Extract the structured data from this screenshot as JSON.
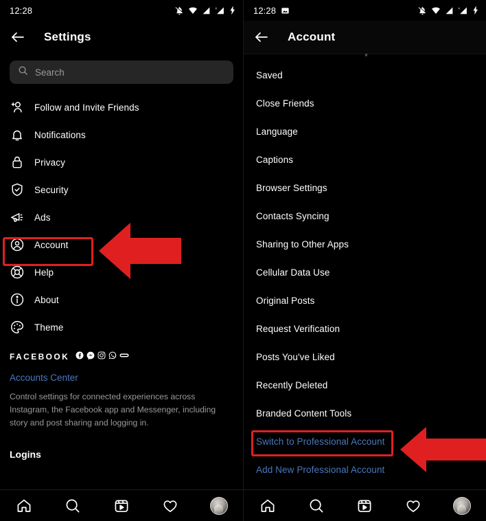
{
  "status": {
    "time": "12:28",
    "left_icons": [
      "image-icon"
    ],
    "right_icons": [
      "bell-muted-icon",
      "wifi-icon",
      "signal-icon",
      "signal-no-sim-icon",
      "battery-charging-icon"
    ]
  },
  "left_panel": {
    "header": {
      "title": "Settings",
      "back_icon": "back-arrow-icon"
    },
    "search": {
      "placeholder": "Search",
      "icon": "search-icon"
    },
    "items": [
      {
        "label": "Follow and Invite Friends",
        "icon": "person-add-icon"
      },
      {
        "label": "Notifications",
        "icon": "bell-icon"
      },
      {
        "label": "Privacy",
        "icon": "lock-icon"
      },
      {
        "label": "Security",
        "icon": "shield-check-icon"
      },
      {
        "label": "Ads",
        "icon": "megaphone-icon"
      },
      {
        "label": "Account",
        "icon": "account-circle-icon"
      },
      {
        "label": "Help",
        "icon": "lifebuoy-icon"
      },
      {
        "label": "About",
        "icon": "info-circle-icon"
      },
      {
        "label": "Theme",
        "icon": "palette-icon"
      }
    ],
    "facebook_section": {
      "brand": "FACEBOOK",
      "brand_icons": [
        "facebook-icon",
        "messenger-icon",
        "instagram-icon",
        "whatsapp-icon",
        "portal-icon"
      ],
      "accounts_center_link": "Accounts Center",
      "description": "Control settings for connected experiences across Instagram, the Facebook app and Messenger, including story and post sharing and logging in."
    },
    "logins_title": "Logins"
  },
  "right_panel": {
    "header": {
      "title": "Account",
      "back_icon": "back-arrow-icon"
    },
    "items": [
      {
        "label": "Saved",
        "type": "normal"
      },
      {
        "label": "Close Friends",
        "type": "normal"
      },
      {
        "label": "Language",
        "type": "normal"
      },
      {
        "label": "Captions",
        "type": "normal"
      },
      {
        "label": "Browser Settings",
        "type": "normal"
      },
      {
        "label": "Contacts Syncing",
        "type": "normal"
      },
      {
        "label": "Sharing to Other Apps",
        "type": "normal"
      },
      {
        "label": "Cellular Data Use",
        "type": "normal"
      },
      {
        "label": "Original Posts",
        "type": "normal"
      },
      {
        "label": "Request Verification",
        "type": "normal"
      },
      {
        "label": "Posts You've Liked",
        "type": "normal"
      },
      {
        "label": "Recently Deleted",
        "type": "normal"
      },
      {
        "label": "Branded Content Tools",
        "type": "normal"
      },
      {
        "label": "Switch to Professional Account",
        "type": "link"
      },
      {
        "label": "Add New Professional Account",
        "type": "link"
      }
    ]
  },
  "bottom_nav": {
    "items": [
      "home-icon",
      "search-icon",
      "reels-icon",
      "heart-icon",
      "profile-avatar"
    ]
  },
  "annotations": {
    "highlight_color": "#e02020",
    "link_color": "#4a78bd",
    "boxes": [
      {
        "target": "Account",
        "panel": "left"
      },
      {
        "target": "Switch to Professional Account",
        "panel": "right"
      }
    ],
    "arrows": [
      {
        "direction": "left",
        "panel": "left"
      },
      {
        "direction": "left",
        "panel": "right"
      }
    ]
  }
}
